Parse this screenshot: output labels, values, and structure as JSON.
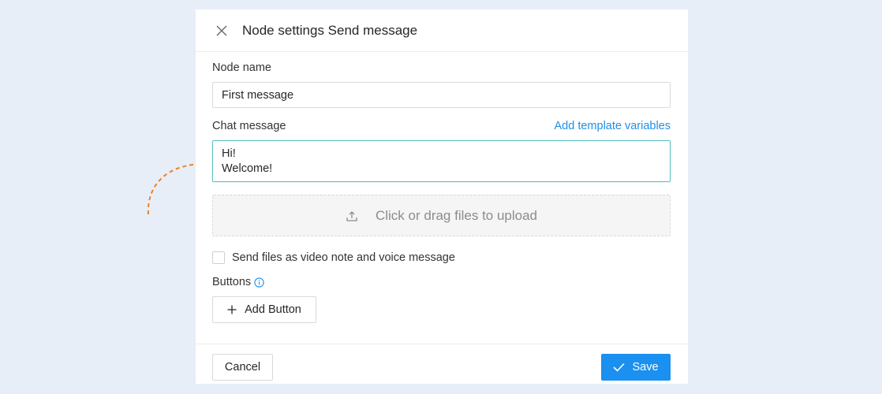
{
  "dialog": {
    "title": "Node settings Send message"
  },
  "form": {
    "node_name_label": "Node name",
    "node_name_value": "First message",
    "chat_message_label": "Chat message",
    "template_link": "Add template variables",
    "chat_message_line1": "Hi!",
    "chat_message_line2": "Welcome!",
    "upload_text": "Click or drag files to upload",
    "checkbox_label": "Send files as video note and voice message",
    "buttons_label": "Buttons",
    "add_button_label": "Add Button"
  },
  "footer": {
    "cancel_label": "Cancel",
    "save_label": "Save"
  },
  "colors": {
    "accent": "#1a90f0",
    "focus_border": "#5cc4c0",
    "arrow": "#e8822a",
    "background": "#e8eef7"
  },
  "icons": {
    "close": "close-icon",
    "upload": "upload-icon",
    "info": "info-icon",
    "plus": "plus-icon",
    "check": "check-icon",
    "arrow": "dashed-arrow-icon"
  }
}
